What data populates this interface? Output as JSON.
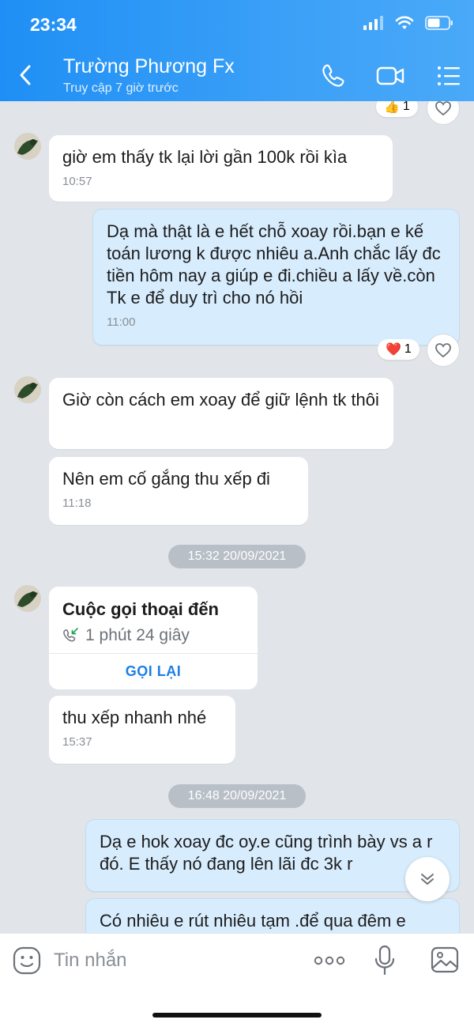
{
  "status_bar": {
    "time": "23:34"
  },
  "header": {
    "contact_name": "Trường Phương Fx",
    "contact_status": "Truy cập 7 giờ trước"
  },
  "reactions": {
    "top": {
      "emoji": "👍",
      "count": "1"
    },
    "out1": {
      "emoji": "❤️",
      "count": "1"
    }
  },
  "messages": [
    {
      "side": "in",
      "text": "giờ em thấy tk lại lời  gần 100k rồi kìa",
      "time": "10:57"
    },
    {
      "side": "out",
      "text": "Dạ mà thật là e hết chỗ xoay rồi.bạn e kế toán lương k được nhiêu a.Anh chắc lấy đc tiền hôm nay a giúp e đi.chiều a lấy về.còn Tk e để duy trì cho nó hồi",
      "time": "11:00"
    },
    {
      "side": "in",
      "text": "Giờ còn cách em xoay để giữ lệnh tk thôi"
    },
    {
      "side": "in",
      "text": "Nên em cố gắng thu xếp đi",
      "time": "11:18"
    },
    {
      "side": "in",
      "text": "thu xếp nhanh nhé",
      "time": "15:37"
    },
    {
      "side": "out",
      "text": "Dạ e hok xoay đc oy.e cũng trình bày vs a r đó. E thấy nó đang lên lãi đc 3k r"
    },
    {
      "side": "out",
      "text": "Có nhiêu e rút nhiêu tạm .để qua đêm e"
    }
  ],
  "date_separators": [
    "15:32 20/09/2021",
    "16:48 20/09/2021"
  ],
  "call": {
    "title": "Cuộc gọi thoại đến",
    "duration": "1 phút 24 giây",
    "action": "GỌI LẠI"
  },
  "input": {
    "placeholder": "Tin nhắn"
  },
  "colors": {
    "header": "#2a97f6",
    "out_bubble": "#d7ecfc",
    "in_bubble": "#ffffff",
    "accent": "#1c7ee6",
    "background": "#e1e5ea"
  }
}
